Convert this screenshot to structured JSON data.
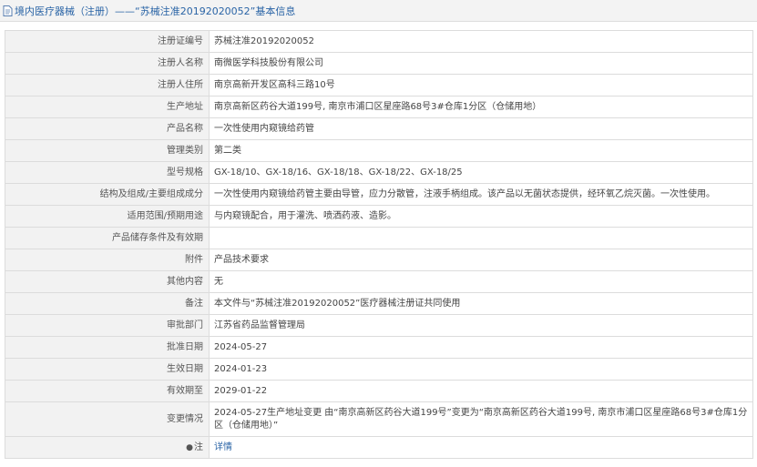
{
  "header": {
    "title": "境内医疗器械（注册）——“苏械注准20192020052”基本信息"
  },
  "rows": [
    {
      "label": "注册证编号",
      "value": "苏械注准20192020052"
    },
    {
      "label": "注册人名称",
      "value": "南微医学科技股份有限公司"
    },
    {
      "label": "注册人住所",
      "value": "南京高新开发区高科三路10号"
    },
    {
      "label": "生产地址",
      "value": "南京高新区药谷大道199号, 南京市浦口区星座路68号3#仓库1分区（仓储用地）"
    },
    {
      "label": "产品名称",
      "value": "一次性使用内窥镜给药管"
    },
    {
      "label": "管理类别",
      "value": "第二类"
    },
    {
      "label": "型号规格",
      "value": "GX-18/10、GX-18/16、GX-18/18、GX-18/22、GX-18/25"
    },
    {
      "label": "结构及组成/主要组成成分",
      "value": "一次性使用内窥镜给药管主要由导管，应力分散管，注液手柄组成。该产品以无菌状态提供，经环氧乙烷灭菌。一次性使用。"
    },
    {
      "label": "适用范围/预期用途",
      "value": "与内窥镜配合，用于灌洗、喷洒药液、造影。"
    },
    {
      "label": "产品储存条件及有效期",
      "value": ""
    },
    {
      "label": "附件",
      "value": "产品技术要求"
    },
    {
      "label": "其他内容",
      "value": "无"
    },
    {
      "label": "备注",
      "value": "本文件与“苏械注准20192020052”医疗器械注册证共同使用"
    },
    {
      "label": "审批部门",
      "value": "江苏省药品监督管理局"
    },
    {
      "label": "批准日期",
      "value": "2024-05-27"
    },
    {
      "label": "生效日期",
      "value": "2024-01-23"
    },
    {
      "label": "有效期至",
      "value": "2029-01-22"
    },
    {
      "label": "变更情况",
      "value": "2024-05-27生产地址变更 由“南京高新区药谷大道199号”变更为“南京高新区药谷大道199号, 南京市浦口区星座路68号3#仓库1分区（仓储用地）”"
    }
  ],
  "note_row": {
    "pin_icon": "pin-icon",
    "label": "注",
    "link": "详情"
  }
}
